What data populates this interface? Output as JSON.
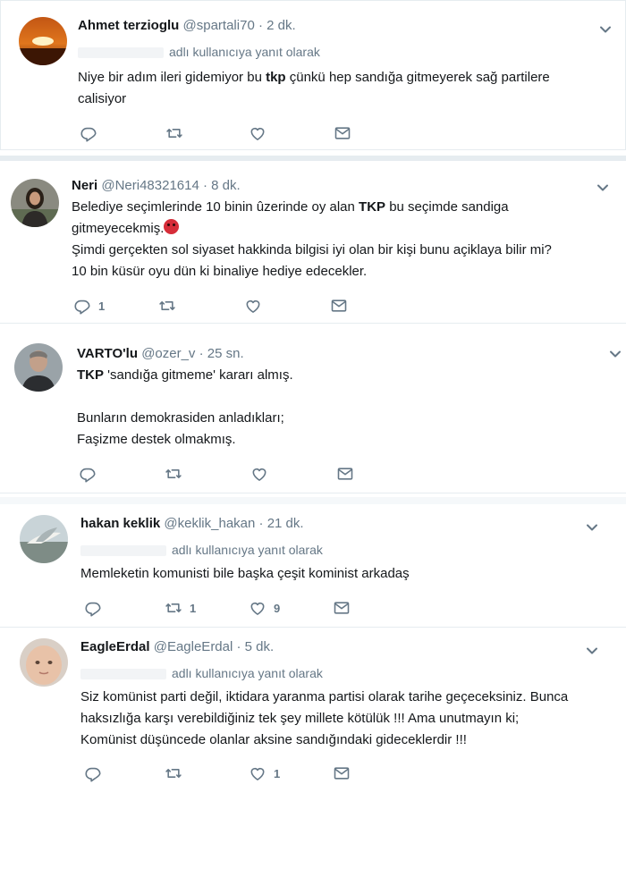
{
  "tweets": [
    {
      "name": "Ahmet terzioglu",
      "handle": "@spartali70",
      "time": "2 dk.",
      "reply_to": "adlı kullanıcıya yanıt olarak",
      "text_parts": [
        "Niye bir adım ileri gidemiyor bu ",
        "tkp",
        " çünkü hep sandığa gitmeyerek sağ partilere\ncalisiyor"
      ],
      "actions": {
        "reply": "",
        "retweet": "",
        "like": ""
      },
      "avatar": "sunset-avatar"
    },
    {
      "name": "Neri",
      "handle": "@Neri48321614",
      "time": "8 dk.",
      "text_parts": [
        "Belediye seçimlerinde 10 binin ûzerinde oy alan ",
        "TKP",
        " bu seçimde sandiga\ngitmeyecekmiş."
      ],
      "text_more": "Şimdi gerçekten sol siyaset hakkinda  bilgisi iyi olan bir kişi bunu açiklaya bilir mi?\n10 bin küsür oyu dün ki binaliye hediye edecekler.",
      "actions": {
        "reply": "1",
        "retweet": "",
        "like": ""
      },
      "avatar": "woman-avatar"
    },
    {
      "name": "VARTO'lu",
      "handle": "@ozer_v",
      "time": "25 sn.",
      "text_parts": [
        "",
        "TKP",
        "  'sandığa gitmeme' kararı almış."
      ],
      "text_more": "Bunların demokrasiden anladıkları;\nFaşizme destek olmakmış.",
      "actions": {
        "reply": "",
        "retweet": "",
        "like": ""
      },
      "avatar": "man-avatar"
    },
    {
      "name": "hakan keklik",
      "handle": "@keklik_hakan",
      "time": "21 dk.",
      "reply_to": "adlı kullanıcıya yanıt olarak",
      "text": "Memleketin komunisti bile başka çeşit kominist arkadaş",
      "actions": {
        "reply": "",
        "retweet": "1",
        "like": "9"
      },
      "avatar": "bird-avatar"
    },
    {
      "name": "EagleErdal",
      "handle": "@EagleErdal",
      "time": "5 dk.",
      "reply_to": "adlı kullanıcıya yanıt olarak",
      "text": "Siz komünist parti değil, iktidara yaranma partisi olarak tarihe geçeceksiniz. Bunca\nhaksızlığa karşı verebildiğiniz tek şey millete kötülük !!! Ama unutmayın ki;\nKomünist düşüncede olanlar aksine sandığındaki gideceklerdir !!!",
      "actions": {
        "reply": "",
        "retweet": "",
        "like": "1"
      },
      "avatar": "child-avatar"
    }
  ],
  "dot": "·",
  "colors": {
    "text": "#14171a",
    "muted": "#657786",
    "border": "#e6ecf0"
  }
}
